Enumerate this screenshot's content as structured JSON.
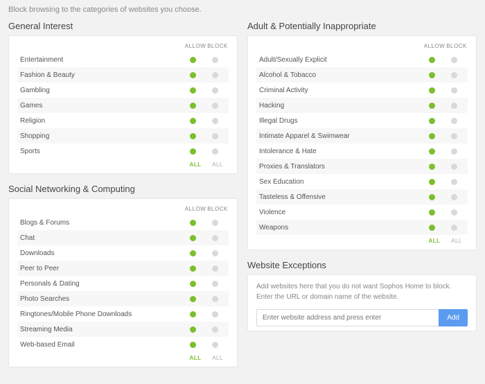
{
  "description": "Block browsing to the categories of websites you choose.",
  "header_allow": "ALLOW",
  "header_block": "BLOCK",
  "footer_all": "ALL",
  "sections": {
    "general": {
      "title": "General Interest",
      "items": [
        {
          "label": "Entertainment",
          "state": "allow"
        },
        {
          "label": "Fashion & Beauty",
          "state": "allow"
        },
        {
          "label": "Gambling",
          "state": "allow"
        },
        {
          "label": "Games",
          "state": "allow"
        },
        {
          "label": "Religion",
          "state": "allow"
        },
        {
          "label": "Shopping",
          "state": "allow"
        },
        {
          "label": "Sports",
          "state": "allow"
        }
      ]
    },
    "social": {
      "title": "Social Networking & Computing",
      "items": [
        {
          "label": "Blogs & Forums",
          "state": "allow"
        },
        {
          "label": "Chat",
          "state": "allow"
        },
        {
          "label": "Downloads",
          "state": "allow"
        },
        {
          "label": "Peer to Peer",
          "state": "allow"
        },
        {
          "label": "Personals & Dating",
          "state": "allow"
        },
        {
          "label": "Photo Searches",
          "state": "allow"
        },
        {
          "label": "Ringtones/Mobile Phone Downloads",
          "state": "allow"
        },
        {
          "label": "Streaming Media",
          "state": "allow"
        },
        {
          "label": "Web-based Email",
          "state": "allow"
        }
      ]
    },
    "adult": {
      "title": "Adult & Potentially Inappropriate",
      "items": [
        {
          "label": "Adult/Sexually Explicit",
          "state": "allow"
        },
        {
          "label": "Alcohol & Tobacco",
          "state": "allow"
        },
        {
          "label": "Criminal Activity",
          "state": "allow"
        },
        {
          "label": "Hacking",
          "state": "allow"
        },
        {
          "label": "Illegal Drugs",
          "state": "allow"
        },
        {
          "label": "Intimate Apparel & Swimwear",
          "state": "allow"
        },
        {
          "label": "Intolerance & Hate",
          "state": "allow"
        },
        {
          "label": "Proxies & Translators",
          "state": "allow"
        },
        {
          "label": "Sex Education",
          "state": "allow"
        },
        {
          "label": "Tasteless & Offensive",
          "state": "allow"
        },
        {
          "label": "Violence",
          "state": "allow"
        },
        {
          "label": "Weapons",
          "state": "allow"
        }
      ]
    }
  },
  "exceptions": {
    "title": "Website Exceptions",
    "desc": "Add websites here that you do not want Sophos Home to block. Enter the URL or domain name of the website.",
    "placeholder": "Enter website address and press enter",
    "button": "Add"
  }
}
